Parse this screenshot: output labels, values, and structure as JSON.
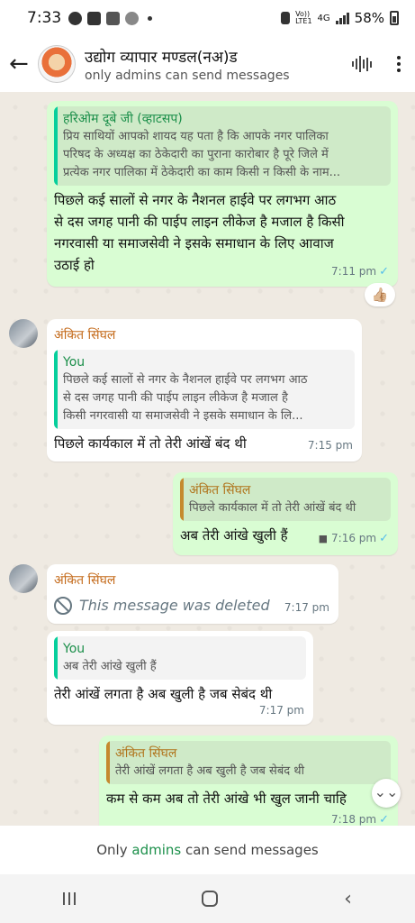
{
  "status": {
    "time": "7:33",
    "net_top": "Vo))",
    "net_bottom": "LTE1",
    "net_type": "4G",
    "battery": "58%"
  },
  "header": {
    "title": "उद्योग व्यापार मण्डल(नअ)ड",
    "subtitle": "only admins can send messages",
    "back_icon": "arrow-left-icon",
    "menu_icon": "kebab-menu-icon"
  },
  "messages": [
    {
      "quote_name": "हरिओम दूबे जी (व्हाटसप)",
      "quote_lines": [
        "प्रिय साथियों आपको शायद यह पता है कि आपके नगर पालिका",
        "परिषद के अध्यक्ष का ठेकेदारी का पुराना कारोबार है पूरे जिले में",
        "प्रत्येक नगर पालिका में ठेकेदारी का काम किसी न किसी के नाम..."
      ],
      "text_lines": [
        "पिछले कई सालों से नगर के नैशनल हाईवे पर लगभग आठ",
        "से दस जगह पानी की पाईप लाइन लीकेज है मजाल है किसी",
        "नगरवासी या समाजसेवी ने इसके समाधान के लिए आवाज",
        "उठाई हो"
      ],
      "time": "7:11 pm",
      "reaction": "👍🏼"
    },
    {
      "sender": "अंकित सिंघल",
      "quote_name": "You",
      "quote_lines": [
        "पिछले कई सालों से नगर के नैशनल हाईवे पर लगभग आठ",
        "से दस जगह पानी की पाईप लाइन लीकेज है मजाल है",
        "किसी नगरवासी या समाजसेवी ने इसके समाधान के लि..."
      ],
      "text": "पिछले कार्यकाल में तो तेरी आंखें बंद थी",
      "time": "7:15 pm"
    },
    {
      "quote_name": "अंकित सिंघल",
      "quote_text": "पिछले कार्यकाल में तो तेरी आंखें बंद थी",
      "text": "अब तेरी आंखे खुली हैं",
      "time": "7:16 pm"
    },
    {
      "sender": "अंकित सिंघल",
      "deleted_text": "This message was deleted",
      "time": "7:17 pm"
    },
    {
      "quote_name": "You",
      "quote_text": "अब तेरी आंखे खुली हैं",
      "text": "तेरी आंखें लगता है अब खुली है जब सेबंद थी",
      "time": "7:17 pm"
    },
    {
      "quote_name": "अंकित सिंघल",
      "quote_text": "तेरी आंखें लगता है अब खुली है जब सेबंद थी",
      "text": "कम से कम अब तो तेरी आंखे भी खुल जानी चाहि",
      "time": "7:18 pm"
    }
  ],
  "footer": {
    "prefix": "Only ",
    "link": "admins",
    "suffix": " can send messages"
  }
}
